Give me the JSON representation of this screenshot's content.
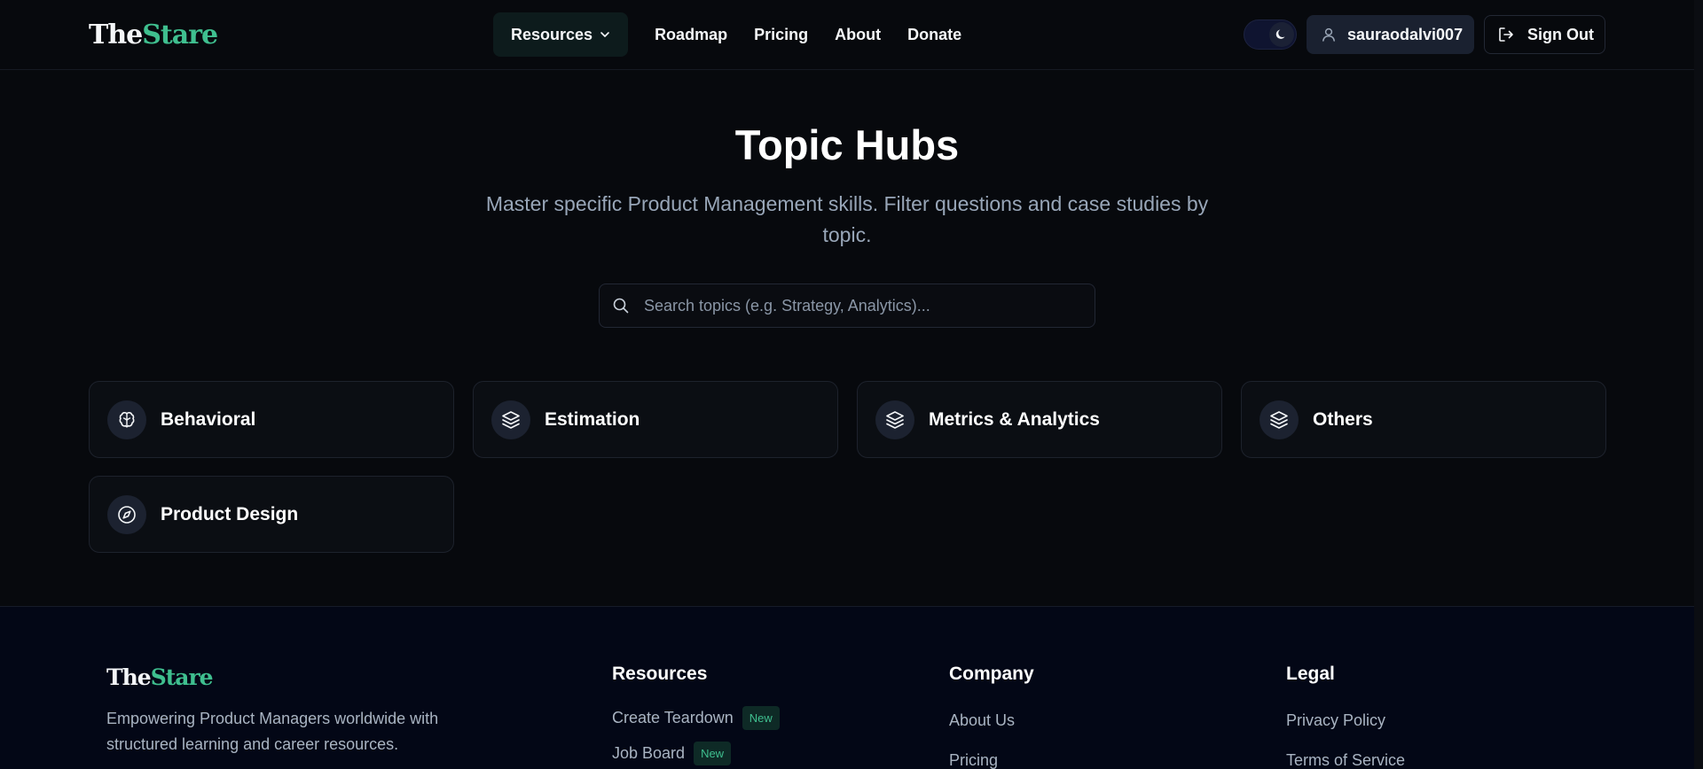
{
  "header": {
    "logo_the": "The",
    "logo_stare": "Stare",
    "nav": {
      "resources": "Resources",
      "roadmap": "Roadmap",
      "pricing": "Pricing",
      "about": "About",
      "donate": "Donate"
    },
    "username": "sauraodalvi007",
    "sign_out": "Sign Out"
  },
  "hero": {
    "title": "Topic Hubs",
    "subtitle": "Master specific Product Management skills. Filter questions and case studies by topic.",
    "search_placeholder": "Search topics (e.g. Strategy, Analytics)..."
  },
  "topics": [
    {
      "label": "Behavioral",
      "icon": "brain-icon"
    },
    {
      "label": "Estimation",
      "icon": "layers-icon"
    },
    {
      "label": "Metrics & Analytics",
      "icon": "layers-icon"
    },
    {
      "label": "Others",
      "icon": "layers-icon"
    },
    {
      "label": "Product Design",
      "icon": "compass-icon"
    }
  ],
  "footer": {
    "logo_the": "The",
    "logo_stare": "Stare",
    "description": "Empowering Product Managers worldwide with structured learning and career resources.",
    "resources": {
      "heading": "Resources",
      "links": [
        {
          "label": "Create Teardown",
          "badge": "New"
        },
        {
          "label": "Job Board",
          "badge": "New"
        }
      ]
    },
    "company": {
      "heading": "Company",
      "links": [
        "About Us",
        "Pricing"
      ]
    },
    "legal": {
      "heading": "Legal",
      "links": [
        "Privacy Policy",
        "Terms of Service"
      ]
    }
  },
  "colors": {
    "background": "#07090d",
    "accent": "#3fbf8f",
    "footer_bg": "#030716",
    "muted_text": "#98a6b8"
  }
}
